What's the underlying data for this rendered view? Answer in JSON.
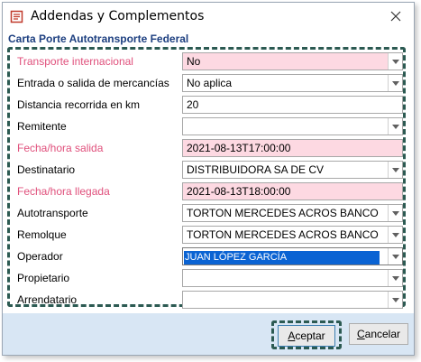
{
  "window": {
    "title": "Addendas y Complementos"
  },
  "section": {
    "title": "Carta Porte Autotransporte Federal"
  },
  "fields": [
    {
      "label": "Transporte internacional",
      "value": "No",
      "required": true,
      "combo": true
    },
    {
      "label": "Entrada o salida de mercancías",
      "value": "No aplica",
      "required": false,
      "combo": true
    },
    {
      "label": "Distancia recorrida en km",
      "value": "20",
      "required": false,
      "combo": false
    },
    {
      "label": "Remitente",
      "value": "",
      "required": false,
      "combo": true
    },
    {
      "label": "Fecha/hora salida",
      "value": "2021-08-13T17:00:00",
      "required": true,
      "combo": false
    },
    {
      "label": "Destinatario",
      "value": "DISTRIBUIDORA SA DE CV",
      "required": false,
      "combo": true
    },
    {
      "label": "Fecha/hora llegada",
      "value": "2021-08-13T18:00:00",
      "required": true,
      "combo": false
    },
    {
      "label": "Autotransporte",
      "value": "TORTON MERCEDES ACROS BANCO",
      "required": false,
      "combo": true
    },
    {
      "label": "Remolque",
      "value": "TORTON MERCEDES ACROS BANCO",
      "required": false,
      "combo": true
    },
    {
      "label": "Operador",
      "value": "JUAN LÓPEZ GARCÍA",
      "required": false,
      "combo": true
    },
    {
      "label": "Propietario",
      "value": "",
      "required": false,
      "combo": true
    },
    {
      "label": "Arrendatario",
      "value": "",
      "required": false,
      "combo": true
    }
  ],
  "buttons": {
    "accept_first": "A",
    "accept_rest": "ceptar",
    "cancel_first": "C",
    "cancel_rest": "ancelar"
  },
  "colors": {
    "required_label": "#e0507c",
    "required_field": "#fdd9e2",
    "section_title": "#1d3f80",
    "footer": "#d8e6f4",
    "selection": "#0a63d3"
  }
}
